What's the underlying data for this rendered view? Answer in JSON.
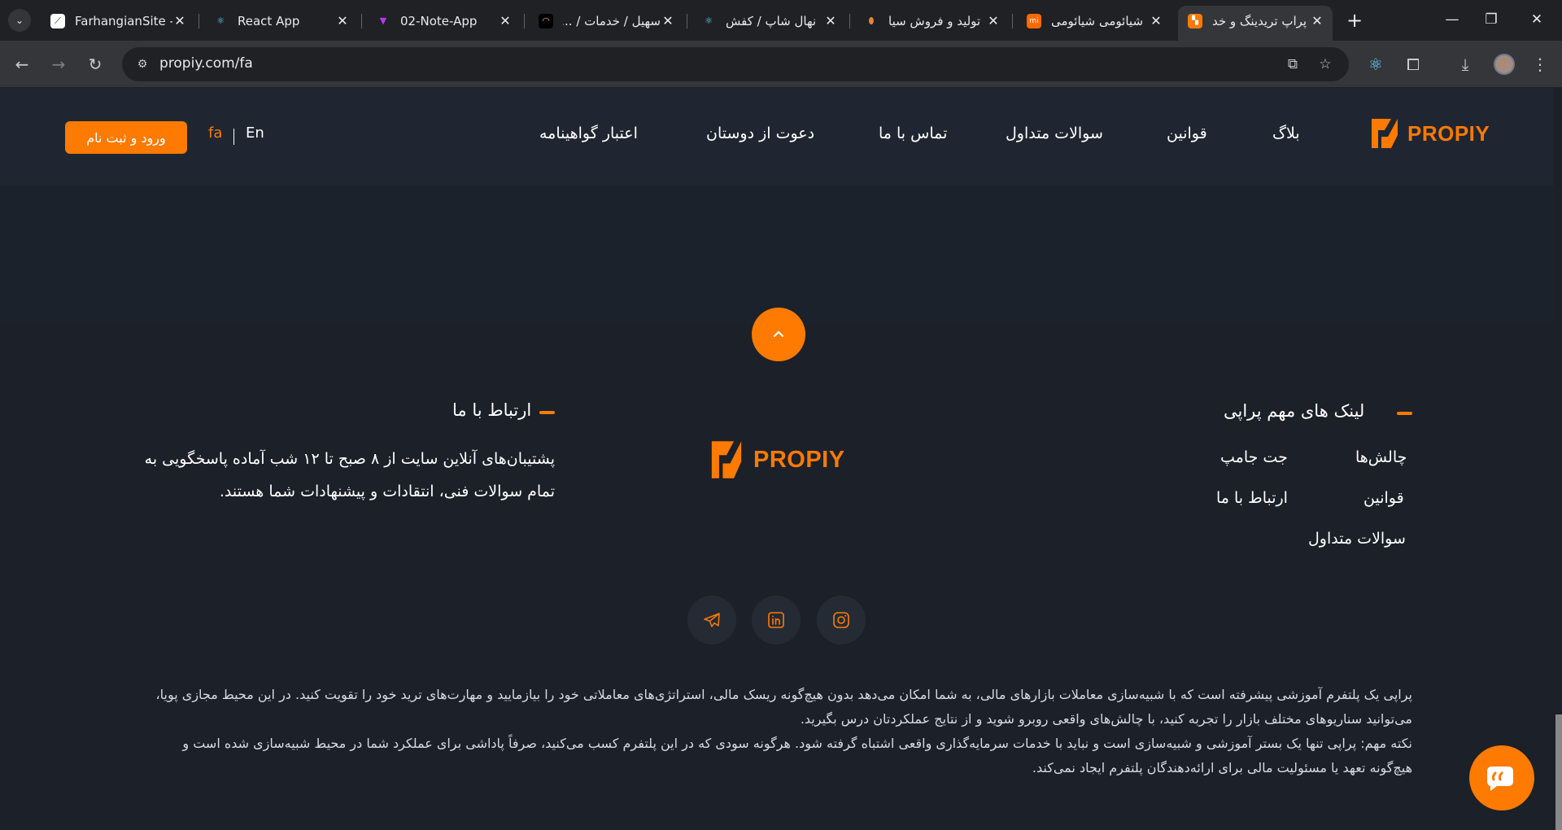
{
  "browser": {
    "tabs": [
      {
        "title": "FarhangianSite -",
        "favicon": "link-favicon",
        "active": false
      },
      {
        "title": "React App",
        "favicon": "react-favicon",
        "active": false
      },
      {
        "title": "02-Note-App",
        "favicon": "vite-favicon",
        "active": false
      },
      {
        "title": "سهیل / خدمات / ...",
        "favicon": "dark-favicon",
        "active": false
      },
      {
        "title": "نهال شاپ / کفش",
        "favicon": "react-favicon",
        "active": false
      },
      {
        "title": "تولید و فروش سیا",
        "favicon": "drop-favicon",
        "active": false
      },
      {
        "title": "شیائومی شیائومی",
        "favicon": "mi-favicon",
        "active": false
      },
      {
        "title": "پراپ تریدینگ و خد",
        "favicon": "propiy-favicon",
        "active": true
      }
    ],
    "url": "propiy.com/fa"
  },
  "header": {
    "logo_text": "PROPIY",
    "nav": [
      "بلاگ",
      "قوانین",
      "سوالات متداول",
      "تماس با ما",
      "دعوت از دوستان",
      "اعتبار گواهینامه"
    ],
    "lang_fa": "fa",
    "lang_en": "En",
    "login_label": "ورود و ثبت نام"
  },
  "footer": {
    "links_title": "لینک های مهم پراپی",
    "links": {
      "col1": [
        "چالش‌ها",
        "قوانین",
        "سوالات متداول"
      ],
      "col2": [
        "جت جامپ",
        "ارتباط با ما"
      ]
    },
    "logo_text": "PROPIY",
    "contact_title": "ارتباط با ما",
    "contact_text": "پشتیبان‌های آنلاین سایت از ۸ صبح تا ۱۲ شب آماده پاسخگویی به تمام سوالات فنی، انتقادات و پیشنهادات شما هستند.",
    "social": [
      "instagram-icon",
      "linkedin-icon",
      "telegram-icon"
    ],
    "disclaimer_1": "پراپی یک پلتفرم آموزشی پیشرفته است که با شبیه‌سازی معاملات بازارهای مالی، به شما امکان می‌دهد بدون هیچ‌گونه ریسک مالی، استراتژی‌های معاملاتی خود را بیازمایید و مهارت‌های ترید خود را تقویت کنید. در این محیط مجازی پویا، می‌توانید سناریوهای مختلف بازار را تجربه کنید، با چالش‌های واقعی روبرو شوید و از نتایج عملکردتان درس بگیرید.",
    "disclaimer_2": "نکته مهم: پراپی تنها یک بستر آموزشی و شبیه‌سازی است و نباید با خدمات سرمایه‌گذاری واقعی اشتباه گرفته شود. هرگونه سودی که در این پلتفرم کسب می‌کنید، صرفاً پاداشی برای عملکرد شما در محیط شبیه‌سازی شده است و هیچ‌گونه تعهد یا مسئولیت مالی برای ارائه‌دهندگان پلتفرم ایجاد نمی‌کند."
  },
  "colors": {
    "accent": "#ff7a00",
    "page_bg": "#1b2029",
    "header_bg": "#1f2631"
  }
}
